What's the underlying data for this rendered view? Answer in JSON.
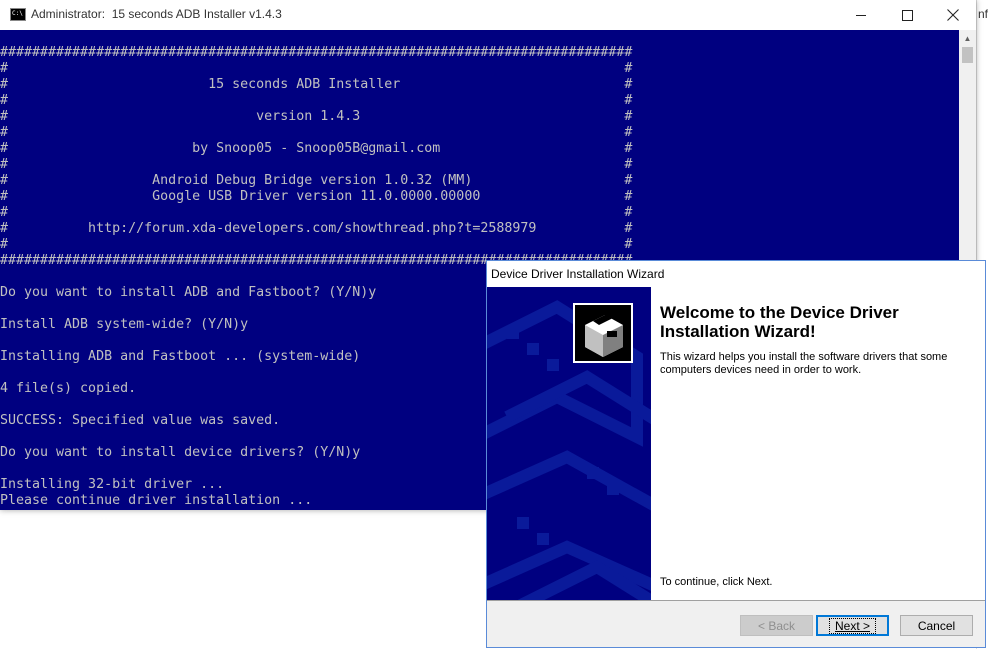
{
  "background_window": {
    "partial_text": "nfo"
  },
  "console": {
    "icon_label": "C:\\",
    "title": "Administrator:  15 seconds ADB Installer v1.4.3",
    "lines": [
      "###############################################################################",
      "#                                                                             #",
      "#                         15 seconds ADB Installer                            #",
      "#                                                                             #",
      "#                               version 1.4.3                                 #",
      "#                                                                             #",
      "#                       by Snoop05 - Snoop05B@gmail.com                       #",
      "#                                                                             #",
      "#                  Android Debug Bridge version 1.0.32 (MM)                   #",
      "#                  Google USB Driver version 11.0.0000.00000                  #",
      "#                                                                             #",
      "#          http://forum.xda-developers.com/showthread.php?t=2588979           #",
      "#                                                                             #",
      "###############################################################################",
      "",
      "Do you want to install ADB and Fastboot? (Y/N)y",
      "",
      "Install ADB system-wide? (Y/N)y",
      "",
      "Installing ADB and Fastboot ... (system-wide)",
      "",
      "4 file(s) copied.",
      "",
      "SUCCESS: Specified value was saved.",
      "",
      "Do you want to install device drivers? (Y/N)y",
      "",
      "Installing 32-bit driver ...",
      "Please continue driver installation ..."
    ]
  },
  "wizard": {
    "title": "Device Driver Installation Wizard",
    "heading": "Welcome to the Device Driver Installation Wizard!",
    "description": "This wizard helps you install the software drivers that some computers devices need in order to work.",
    "continue_text": "To continue, click Next.",
    "back_label": "< Back",
    "next_label": "Next >",
    "cancel_label": "Cancel"
  },
  "colors": {
    "console_background": "#000080",
    "console_text": "#c0c0c0",
    "wizard_sidebar": "#000080",
    "focus_border": "#0078d7"
  }
}
